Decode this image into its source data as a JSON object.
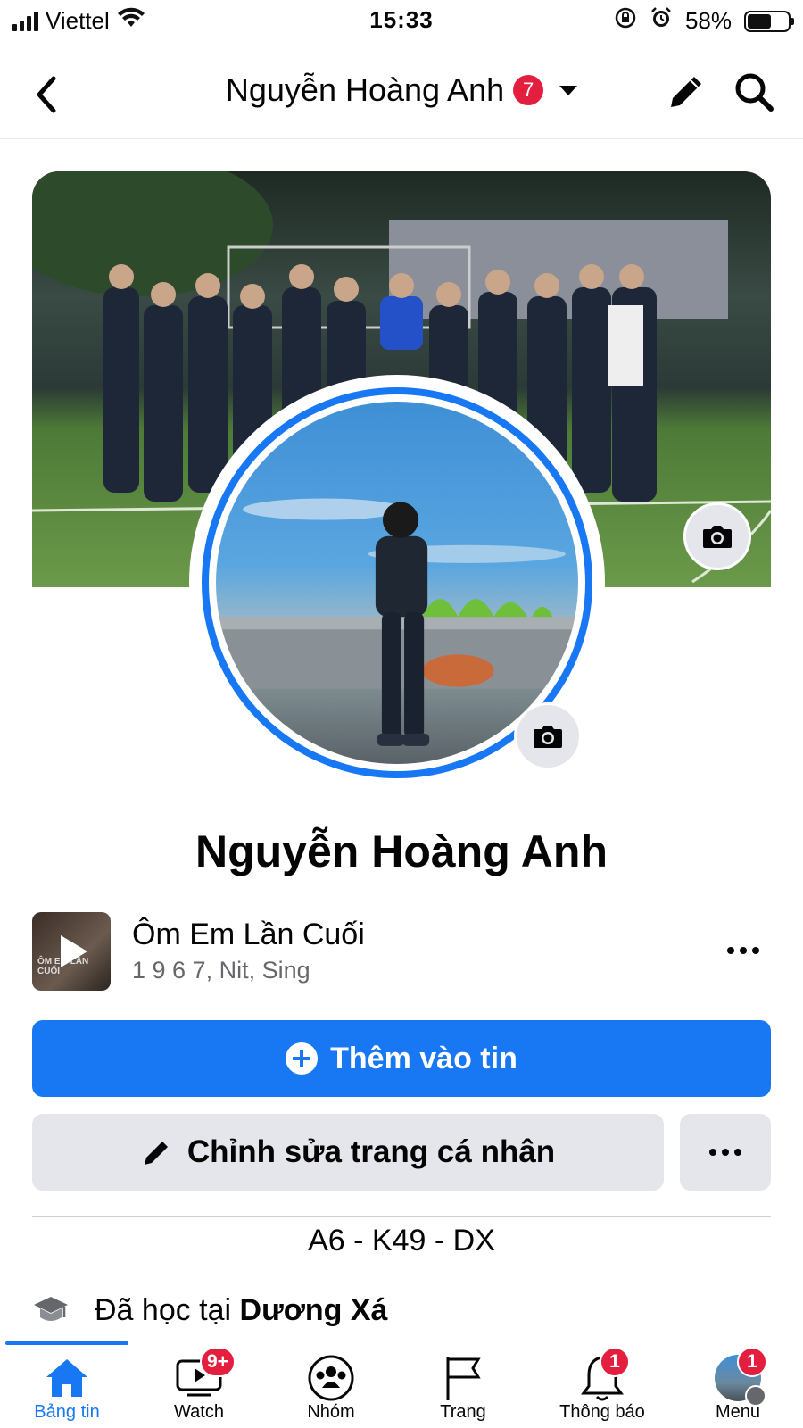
{
  "status_bar": {
    "carrier": "Viettel",
    "time": "15:33",
    "battery": "58%",
    "battery_level": 0.58
  },
  "header": {
    "title": "Nguyễn Hoàng Anh",
    "badge": "7"
  },
  "profile": {
    "name": "Nguyễn Hoàng Anh",
    "bio": "A6 - K49 - DX"
  },
  "music": {
    "thumb_text": "ÔM EM LẦN CUỐI",
    "title": "Ôm Em Lần Cuối",
    "artist": "1 9 6 7, Nit, Sing"
  },
  "buttons": {
    "add_story": "Thêm vào tin",
    "edit_profile": "Chỉnh sửa trang cá nhân"
  },
  "education": {
    "prefix": "Đã học tại ",
    "school": "Dương Xá"
  },
  "tabs": [
    {
      "label": "Bảng tin",
      "icon": "home-icon",
      "badge": ""
    },
    {
      "label": "Watch",
      "icon": "watch-icon",
      "badge": "9+"
    },
    {
      "label": "Nhóm",
      "icon": "groups-icon",
      "badge": ""
    },
    {
      "label": "Trang",
      "icon": "flag-icon",
      "badge": ""
    },
    {
      "label": "Thông báo",
      "icon": "bell-icon",
      "badge": "1"
    },
    {
      "label": "Menu",
      "icon": "menu-avatar-icon",
      "badge": "1"
    }
  ],
  "colors": {
    "accent": "#1877f2",
    "badge": "#e41e3f",
    "secondary_button": "#e4e6eb"
  }
}
